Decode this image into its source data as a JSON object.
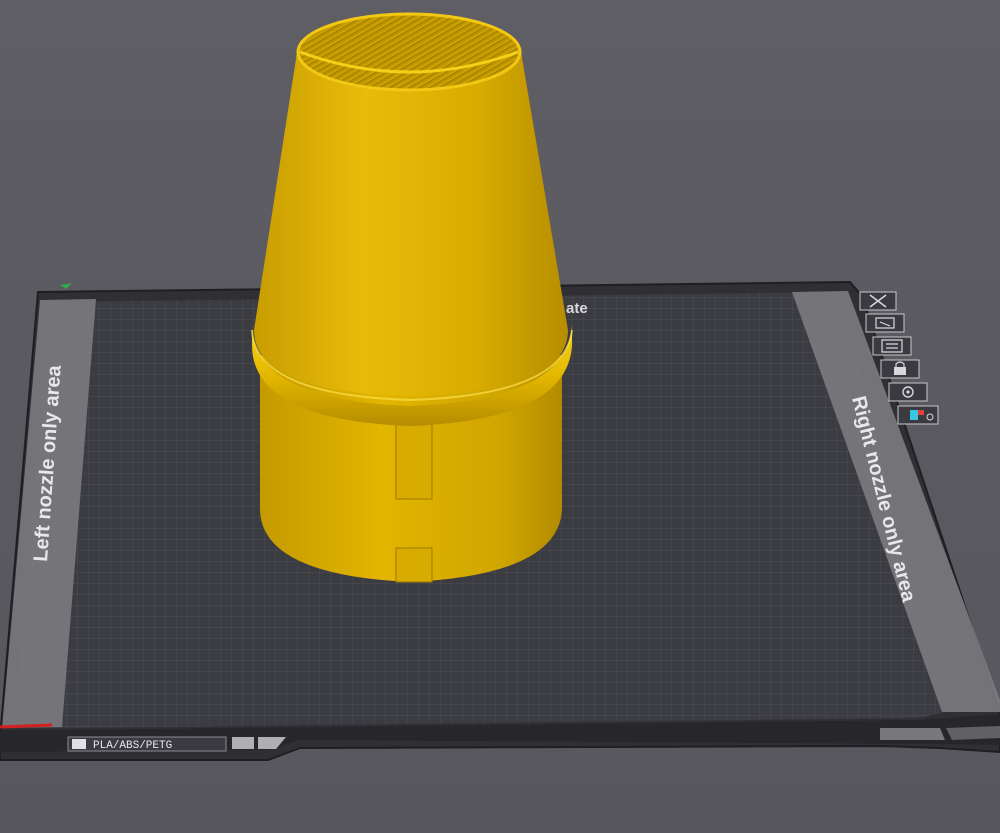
{
  "plate": {
    "tag_partial": "ate",
    "left_zone_label": "Left nozzle only area",
    "right_zone_label": "Right nozzle only area",
    "filament_label": "PLA/ABS/PETG"
  },
  "plate_toolbar": {
    "icons": [
      "close-icon",
      "auto-orient-icon",
      "arrange-icon",
      "lock-icon",
      "settings-icon",
      "plate-filament-icon"
    ]
  },
  "model": {
    "color": "#e6b800"
  }
}
